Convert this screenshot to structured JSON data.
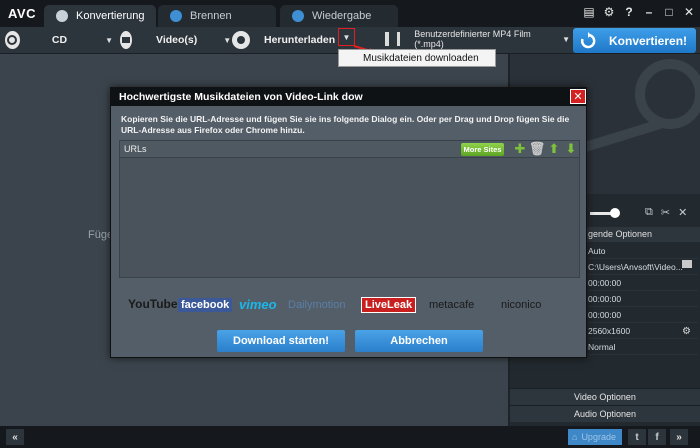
{
  "app": {
    "logo": "AVC"
  },
  "tabs": [
    {
      "label": "Konvertierung",
      "active": true
    },
    {
      "label": "Brennen",
      "active": false
    },
    {
      "label": "Wiedergabe",
      "active": false
    }
  ],
  "window_controls": [
    "feed-icon",
    "gear-icon",
    "help-icon",
    "minimize-icon",
    "maximize-icon",
    "close-icon"
  ],
  "toolbar": {
    "cd_label": "CD",
    "video_label": "Video(s)",
    "download_label": "Herunterladen",
    "format_label": "Benutzerdefinierter MP4 Film (*.mp4)",
    "convert_label": "Konvertieren!"
  },
  "popup": {
    "item": "Musikdateien downloaden"
  },
  "main": {
    "hint": "Füger"
  },
  "right_panel": {
    "options_header": "gende Optionen",
    "rows": [
      "Auto",
      "C:\\Users\\Anvsoft\\Video...",
      "00:00:00",
      "00:00:00",
      "00:00:00",
      "2560x1600",
      "Normal"
    ],
    "video_options": "Video Optionen",
    "audio_options": "Audio Optionen"
  },
  "bottom": {
    "upgrade": "Upgrade"
  },
  "dialog": {
    "title": "Hochwertigste Musikdateien von Video-Link dow",
    "description": "Kopieren Sie die URL-Adresse und fügen Sie sie ins folgende Dialog ein. Oder per Drag und Drop fügen Sie die URL-Adresse aus Firefox oder Chrome hinzu.",
    "urls_label": "URLs",
    "more_sites": "More Sites",
    "sites": [
      "YouTube",
      "facebook",
      "vimeo",
      "Dailymotion",
      "LiveLeak",
      "metacafe",
      "niconico"
    ],
    "start_button": "Download starten!",
    "cancel_button": "Abbrechen"
  },
  "colors": {
    "accent": "#2b7fcc",
    "highlight": "#e02020",
    "more_sites": "#6cb42c"
  }
}
